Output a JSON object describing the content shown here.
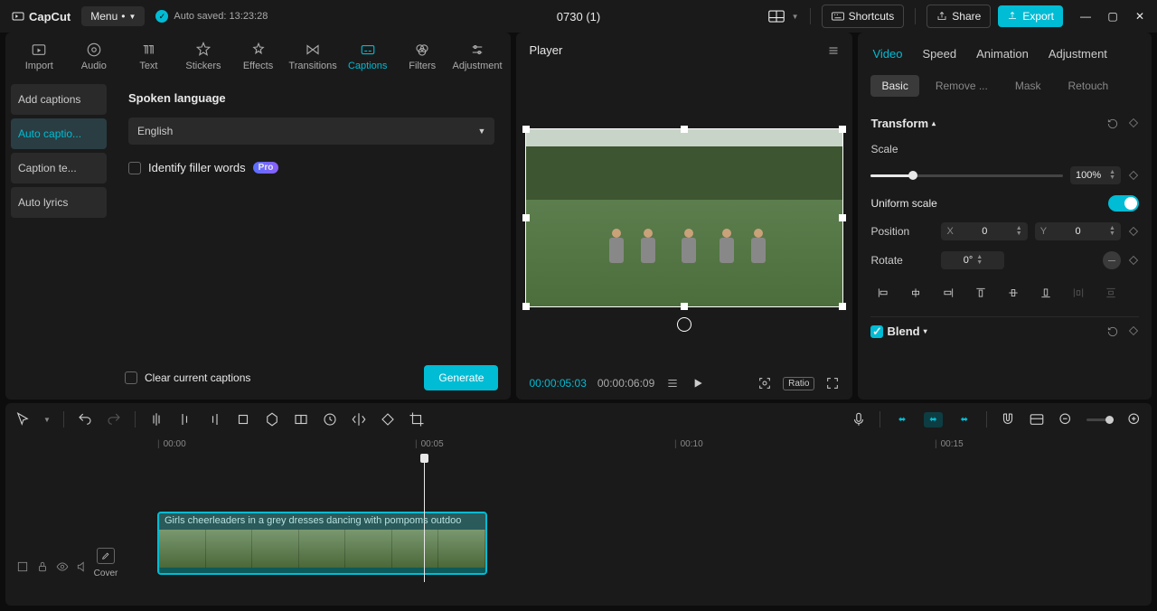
{
  "titlebar": {
    "app_name": "CapCut",
    "menu_label": "Menu",
    "autosave_label": "Auto saved: 13:23:28",
    "project_name": "0730 (1)",
    "shortcuts_label": "Shortcuts",
    "share_label": "Share",
    "export_label": "Export"
  },
  "media_tabs": [
    {
      "id": "import",
      "label": "Import"
    },
    {
      "id": "audio",
      "label": "Audio"
    },
    {
      "id": "text",
      "label": "Text"
    },
    {
      "id": "stickers",
      "label": "Stickers"
    },
    {
      "id": "effects",
      "label": "Effects"
    },
    {
      "id": "transitions",
      "label": "Transitions"
    },
    {
      "id": "captions",
      "label": "Captions",
      "active": true
    },
    {
      "id": "filters",
      "label": "Filters"
    },
    {
      "id": "adjustment",
      "label": "Adjustment"
    }
  ],
  "captions_sidebar": [
    {
      "label": "Add captions"
    },
    {
      "label": "Auto captio...",
      "active": true
    },
    {
      "label": "Caption te..."
    },
    {
      "label": "Auto lyrics"
    }
  ],
  "captions_panel": {
    "heading": "Spoken language",
    "language": "English",
    "filler_label": "Identify filler words",
    "pro_label": "Pro",
    "clear_label": "Clear current captions",
    "generate_label": "Generate"
  },
  "player": {
    "title": "Player",
    "current_time": "00:00:05:03",
    "duration": "00:00:06:09",
    "ratio_label": "Ratio"
  },
  "properties": {
    "tabs": [
      "Video",
      "Speed",
      "Animation",
      "Adjustment"
    ],
    "active_tab": "Video",
    "sub_tabs": [
      "Basic",
      "Remove ...",
      "Mask",
      "Retouch"
    ],
    "active_sub": "Basic",
    "transform_label": "Transform",
    "scale_label": "Scale",
    "scale_value": "100%",
    "scale_percent": 22,
    "uniform_label": "Uniform scale",
    "uniform_on": true,
    "position_label": "Position",
    "pos_x_label": "X",
    "pos_x_value": "0",
    "pos_y_label": "Y",
    "pos_y_value": "0",
    "rotate_label": "Rotate",
    "rotate_value": "0°",
    "blend_label": "Blend"
  },
  "timeline": {
    "ticks": [
      "00:00",
      "00:05",
      "00:10",
      "00:15"
    ],
    "clip_label": "Girls cheerleaders in a grey dresses dancing with pompoms outdoo",
    "cover_label": "Cover"
  }
}
